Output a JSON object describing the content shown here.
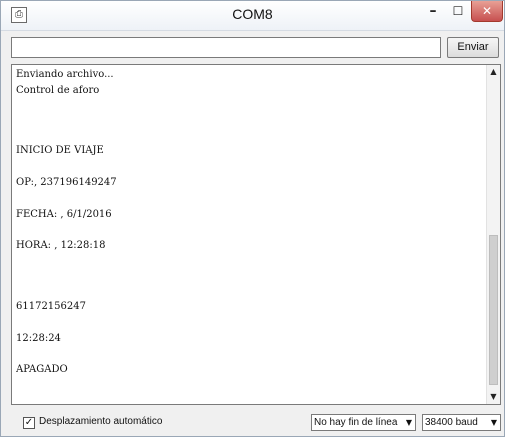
{
  "window": {
    "title": "COM8",
    "icon": "arduino-serial-icon",
    "controls": {
      "minimize": "–",
      "maximize": "☐",
      "close": "✕"
    }
  },
  "send": {
    "input_value": "",
    "button_label": "Enviar"
  },
  "output": {
    "lines": [
      "Enviando archivo...",
      "Control de aforo",
      "INICIO DE VIAJE",
      "OP:, 237196149247",
      "FECHA: , 6/1/2016",
      "HORA: , 12:28:18",
      "61172156247",
      "12:28:24",
      "APAGADO"
    ]
  },
  "status": {
    "autoscroll_checked": true,
    "autoscroll_label": "Desplazamiento automático",
    "line_ending": "No hay fin de línea",
    "baud_rate": "38400 baud"
  },
  "colors": {
    "close_button": "#c75050",
    "background": "#f0f0f0"
  }
}
